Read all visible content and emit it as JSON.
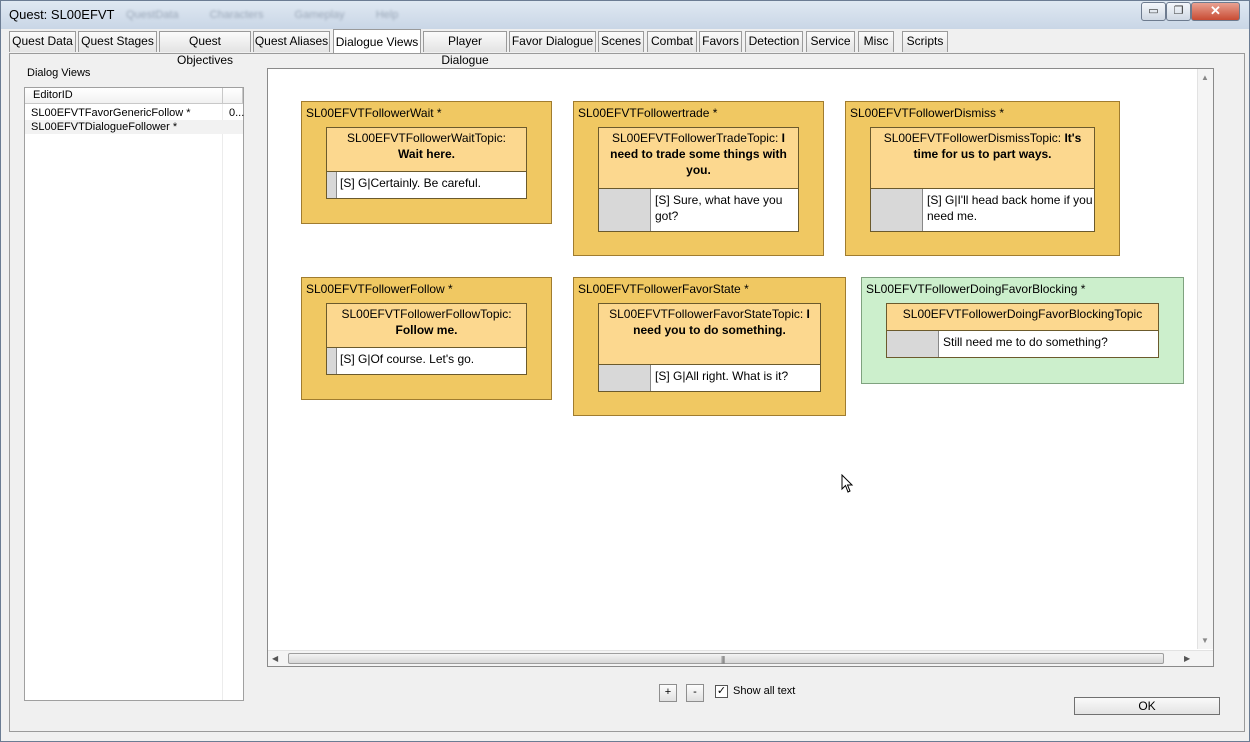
{
  "window": {
    "title": "Quest: SL00EFVT",
    "ghost_menu": [
      "QuestData",
      "Characters",
      "Gameplay",
      "Help"
    ],
    "min_glyph": "▭",
    "max_glyph": "❐",
    "close_glyph": "✕"
  },
  "tabs": [
    {
      "label": "Quest Data"
    },
    {
      "label": "Quest Stages"
    },
    {
      "label": "Quest Objectives"
    },
    {
      "label": "Quest Aliases"
    },
    {
      "label": "Dialogue Views"
    },
    {
      "label": "Player Dialogue"
    },
    {
      "label": "Favor Dialogue"
    },
    {
      "label": "Scenes"
    },
    {
      "label": "Combat"
    },
    {
      "label": "Favors"
    },
    {
      "label": "Detection"
    },
    {
      "label": "Service"
    },
    {
      "label": "Misc"
    },
    {
      "label": "Scripts"
    }
  ],
  "active_tab": "Dialogue Views",
  "dialog_views": {
    "label": "Dialog Views",
    "column_header": "EditorID",
    "rows": [
      {
        "editor_id": "SL00EFVTFavorGenericFollow *",
        "extra": "0..."
      },
      {
        "editor_id": "SL00EFVTDialogueFollower *",
        "extra": ""
      }
    ]
  },
  "nodes": [
    {
      "title": "SL00EFVTFollowerWait *",
      "topic": "SL00EFVTFollowerWaitTopic:",
      "topic_bold": "Wait here.",
      "response": "[S] G|Certainly. Be careful.",
      "color": "#f0c862"
    },
    {
      "title": "SL00EFVTFollowertrade *",
      "topic": "SL00EFVTFollowerTradeTopic:",
      "topic_bold": "I need to trade some things with you.",
      "response": "[S] Sure, what have you got?",
      "color": "#f0c862"
    },
    {
      "title": "SL00EFVTFollowerDismiss *",
      "topic": "SL00EFVTFollowerDismissTopic:",
      "topic_bold": "It's time for us to part ways.",
      "response": "[S] G|I'll head back home if you need me.",
      "color": "#f0c862"
    },
    {
      "title": "SL00EFVTFollowerFollow *",
      "topic": "SL00EFVTFollowerFollowTopic:",
      "topic_bold": "Follow me.",
      "response": "[S] G|Of course. Let's go.",
      "color": "#f0c862"
    },
    {
      "title": "SL00EFVTFollowerFavorState *",
      "topic": "SL00EFVTFollowerFavorStateTopic:",
      "topic_bold": "I need you to do something.",
      "response": "[S] G|All right. What is it?",
      "color": "#f0c862"
    },
    {
      "title": "SL00EFVTFollowerDoingFavorBlocking *",
      "topic": "SL00EFVTFollowerDoingFavorBlockingTopic",
      "topic_bold": "",
      "response": "Still need me to do something?",
      "color": "#ccefcc"
    }
  ],
  "scrollbar": {
    "grip": "|||"
  },
  "controls": {
    "zoom_in": "+",
    "zoom_out": "-",
    "show_all_text_label": "Show all text",
    "show_all_text_checked": true,
    "check_glyph": "✓",
    "ok_label": "OK"
  }
}
